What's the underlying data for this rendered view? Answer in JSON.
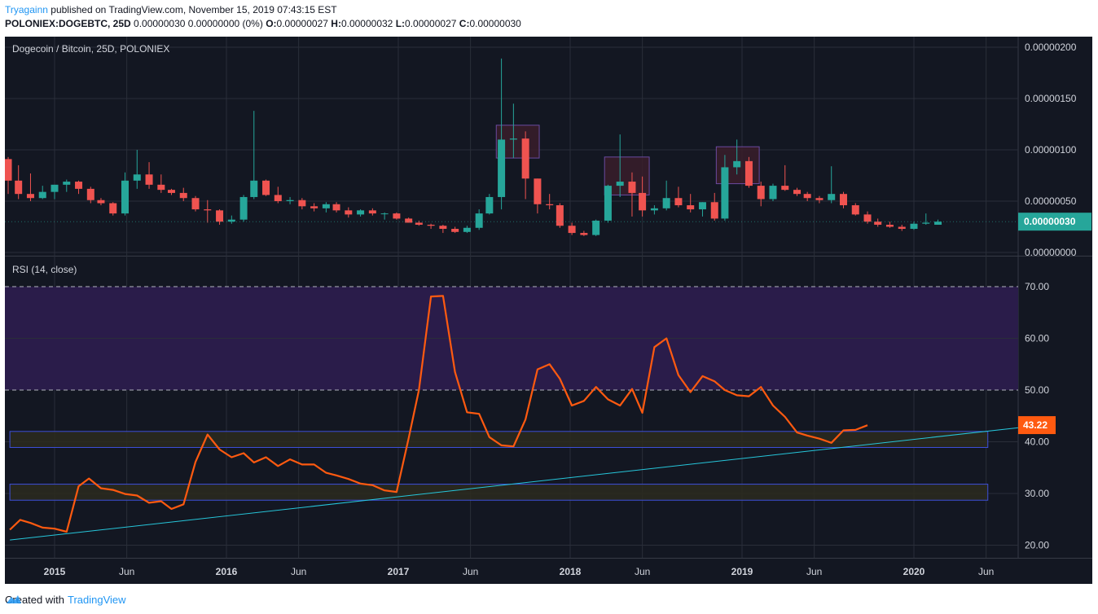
{
  "header": {
    "author": "Tryagainn",
    "published": "published on TradingView.com, November 15, 2019 07:43:15 EST",
    "symbol": "POLONIEX:DOGEBTC, 25D",
    "values_prefix": "0.00000030 0.00000000 (0%)",
    "o_label": "O:",
    "o_val": "0.00000027",
    "h_label": "H:",
    "h_val": "0.00000032",
    "l_label": "L:",
    "l_val": "0.00000027",
    "c_label": "C:",
    "c_val": "0.00000030"
  },
  "footer": {
    "created_with": "Created with",
    "brand": "TradingView"
  },
  "colors": {
    "background": "#131722",
    "grid": "#2a2e39",
    "up": "#26a69a",
    "down": "#ef5350",
    "rsi_line": "#ff5a10",
    "trend_line": "#26c6da",
    "overbought_zone": "#2a1c4a",
    "highlight_box": "#3a1d2a",
    "highlight_border": "#6a4aa0",
    "support_border": "#3d4fd8"
  },
  "chart_data": [
    {
      "type": "candlestick",
      "title": "Dogecoin / Bitcoin, 25D, POLONIEX",
      "unit_note": "price in BTC",
      "ylim": [
        0,
        2e-06
      ],
      "y_ticks": [
        "0.00000200",
        "0.00000150",
        "0.00000100",
        "0.00000050",
        "0.00000000"
      ],
      "last_price_label": "0.00000030",
      "x_ticks": [
        "2015",
        "Jun",
        "2016",
        "Jun",
        "2017",
        "Jun",
        "2018",
        "Jun",
        "2019",
        "Jun",
        "2020",
        "Jun"
      ],
      "x_tick_times": [
        2015.0,
        2015.42,
        2016.0,
        2016.42,
        2017.0,
        2017.42,
        2018.0,
        2018.42,
        2019.0,
        2019.42,
        2020.0,
        2020.42
      ],
      "candles": [
        {
          "t": 2014.73,
          "o": 0.91,
          "h": 0.93,
          "l": 0.57,
          "c": 0.7
        },
        {
          "t": 2014.79,
          "o": 0.7,
          "h": 0.85,
          "l": 0.52,
          "c": 0.57
        },
        {
          "t": 2014.86,
          "o": 0.57,
          "h": 0.77,
          "l": 0.5,
          "c": 0.53
        },
        {
          "t": 2014.93,
          "o": 0.53,
          "h": 0.65,
          "l": 0.52,
          "c": 0.59
        },
        {
          "t": 2015.0,
          "o": 0.59,
          "h": 0.66,
          "l": 0.52,
          "c": 0.66
        },
        {
          "t": 2015.07,
          "o": 0.66,
          "h": 0.71,
          "l": 0.59,
          "c": 0.69
        },
        {
          "t": 2015.14,
          "o": 0.69,
          "h": 0.7,
          "l": 0.57,
          "c": 0.62
        },
        {
          "t": 2015.21,
          "o": 0.62,
          "h": 0.64,
          "l": 0.48,
          "c": 0.51
        },
        {
          "t": 2015.27,
          "o": 0.51,
          "h": 0.53,
          "l": 0.46,
          "c": 0.48
        },
        {
          "t": 2015.34,
          "o": 0.48,
          "h": 0.49,
          "l": 0.36,
          "c": 0.38
        },
        {
          "t": 2015.41,
          "o": 0.38,
          "h": 0.78,
          "l": 0.36,
          "c": 0.7
        },
        {
          "t": 2015.48,
          "o": 0.7,
          "h": 1.0,
          "l": 0.62,
          "c": 0.76
        },
        {
          "t": 2015.55,
          "o": 0.76,
          "h": 0.88,
          "l": 0.62,
          "c": 0.66
        },
        {
          "t": 2015.62,
          "o": 0.66,
          "h": 0.76,
          "l": 0.58,
          "c": 0.61
        },
        {
          "t": 2015.68,
          "o": 0.61,
          "h": 0.62,
          "l": 0.56,
          "c": 0.58
        },
        {
          "t": 2015.75,
          "o": 0.58,
          "h": 0.63,
          "l": 0.5,
          "c": 0.53
        },
        {
          "t": 2015.82,
          "o": 0.53,
          "h": 0.55,
          "l": 0.4,
          "c": 0.42
        },
        {
          "t": 2015.89,
          "o": 0.42,
          "h": 0.51,
          "l": 0.29,
          "c": 0.41
        },
        {
          "t": 2015.96,
          "o": 0.41,
          "h": 0.42,
          "l": 0.27,
          "c": 0.3
        },
        {
          "t": 2016.03,
          "o": 0.3,
          "h": 0.36,
          "l": 0.28,
          "c": 0.32
        },
        {
          "t": 2016.1,
          "o": 0.32,
          "h": 0.56,
          "l": 0.3,
          "c": 0.54
        },
        {
          "t": 2016.16,
          "o": 0.54,
          "h": 1.38,
          "l": 0.52,
          "c": 0.7
        },
        {
          "t": 2016.23,
          "o": 0.7,
          "h": 0.71,
          "l": 0.55,
          "c": 0.56
        },
        {
          "t": 2016.3,
          "o": 0.56,
          "h": 0.64,
          "l": 0.48,
          "c": 0.5
        },
        {
          "t": 2016.37,
          "o": 0.5,
          "h": 0.54,
          "l": 0.47,
          "c": 0.51
        },
        {
          "t": 2016.44,
          "o": 0.51,
          "h": 0.53,
          "l": 0.42,
          "c": 0.45
        },
        {
          "t": 2016.51,
          "o": 0.45,
          "h": 0.48,
          "l": 0.4,
          "c": 0.43
        },
        {
          "t": 2016.58,
          "o": 0.43,
          "h": 0.49,
          "l": 0.39,
          "c": 0.47
        },
        {
          "t": 2016.64,
          "o": 0.47,
          "h": 0.49,
          "l": 0.39,
          "c": 0.41
        },
        {
          "t": 2016.71,
          "o": 0.41,
          "h": 0.44,
          "l": 0.34,
          "c": 0.37
        },
        {
          "t": 2016.78,
          "o": 0.37,
          "h": 0.42,
          "l": 0.35,
          "c": 0.41
        },
        {
          "t": 2016.85,
          "o": 0.41,
          "h": 0.43,
          "l": 0.36,
          "c": 0.38
        },
        {
          "t": 2016.92,
          "o": 0.38,
          "h": 0.39,
          "l": 0.32,
          "c": 0.38
        },
        {
          "t": 2016.99,
          "o": 0.38,
          "h": 0.39,
          "l": 0.32,
          "c": 0.33
        },
        {
          "t": 2017.06,
          "o": 0.33,
          "h": 0.34,
          "l": 0.29,
          "c": 0.29
        },
        {
          "t": 2017.12,
          "o": 0.29,
          "h": 0.31,
          "l": 0.26,
          "c": 0.27
        },
        {
          "t": 2017.19,
          "o": 0.27,
          "h": 0.28,
          "l": 0.23,
          "c": 0.26
        },
        {
          "t": 2017.26,
          "o": 0.26,
          "h": 0.27,
          "l": 0.19,
          "c": 0.23
        },
        {
          "t": 2017.33,
          "o": 0.23,
          "h": 0.25,
          "l": 0.19,
          "c": 0.2
        },
        {
          "t": 2017.4,
          "o": 0.2,
          "h": 0.26,
          "l": 0.19,
          "c": 0.24
        },
        {
          "t": 2017.47,
          "o": 0.24,
          "h": 0.42,
          "l": 0.22,
          "c": 0.38
        },
        {
          "t": 2017.53,
          "o": 0.38,
          "h": 0.57,
          "l": 0.37,
          "c": 0.54
        },
        {
          "t": 2017.6,
          "o": 0.54,
          "h": 1.89,
          "l": 0.42,
          "c": 1.1
        },
        {
          "t": 2017.67,
          "o": 1.1,
          "h": 1.45,
          "l": 0.92,
          "c": 1.11
        },
        {
          "t": 2017.74,
          "o": 1.11,
          "h": 1.18,
          "l": 0.52,
          "c": 0.72
        },
        {
          "t": 2017.81,
          "o": 0.72,
          "h": 0.72,
          "l": 0.38,
          "c": 0.47
        },
        {
          "t": 2017.88,
          "o": 0.47,
          "h": 0.57,
          "l": 0.42,
          "c": 0.46
        },
        {
          "t": 2017.94,
          "o": 0.46,
          "h": 0.48,
          "l": 0.24,
          "c": 0.26
        },
        {
          "t": 2018.01,
          "o": 0.26,
          "h": 0.29,
          "l": 0.17,
          "c": 0.19
        },
        {
          "t": 2018.08,
          "o": 0.19,
          "h": 0.21,
          "l": 0.16,
          "c": 0.17
        },
        {
          "t": 2018.15,
          "o": 0.17,
          "h": 0.32,
          "l": 0.16,
          "c": 0.31
        },
        {
          "t": 2018.22,
          "o": 0.31,
          "h": 0.66,
          "l": 0.29,
          "c": 0.65
        },
        {
          "t": 2018.29,
          "o": 0.65,
          "h": 1.15,
          "l": 0.54,
          "c": 0.69
        },
        {
          "t": 2018.36,
          "o": 0.69,
          "h": 0.78,
          "l": 0.35,
          "c": 0.58
        },
        {
          "t": 2018.42,
          "o": 0.58,
          "h": 0.74,
          "l": 0.35,
          "c": 0.41
        },
        {
          "t": 2018.49,
          "o": 0.41,
          "h": 0.46,
          "l": 0.37,
          "c": 0.43
        },
        {
          "t": 2018.56,
          "o": 0.43,
          "h": 0.7,
          "l": 0.41,
          "c": 0.53
        },
        {
          "t": 2018.63,
          "o": 0.53,
          "h": 0.64,
          "l": 0.44,
          "c": 0.46
        },
        {
          "t": 2018.7,
          "o": 0.46,
          "h": 0.57,
          "l": 0.39,
          "c": 0.42
        },
        {
          "t": 2018.77,
          "o": 0.42,
          "h": 0.49,
          "l": 0.35,
          "c": 0.49
        },
        {
          "t": 2018.84,
          "o": 0.49,
          "h": 0.58,
          "l": 0.31,
          "c": 0.33
        },
        {
          "t": 2018.9,
          "o": 0.33,
          "h": 0.95,
          "l": 0.31,
          "c": 0.83
        },
        {
          "t": 2018.97,
          "o": 0.83,
          "h": 1.1,
          "l": 0.76,
          "c": 0.89
        },
        {
          "t": 2019.04,
          "o": 0.89,
          "h": 0.93,
          "l": 0.63,
          "c": 0.65
        },
        {
          "t": 2019.11,
          "o": 0.65,
          "h": 0.69,
          "l": 0.45,
          "c": 0.52
        },
        {
          "t": 2019.18,
          "o": 0.52,
          "h": 0.67,
          "l": 0.5,
          "c": 0.65
        },
        {
          "t": 2019.25,
          "o": 0.65,
          "h": 0.85,
          "l": 0.6,
          "c": 0.61
        },
        {
          "t": 2019.32,
          "o": 0.61,
          "h": 0.63,
          "l": 0.55,
          "c": 0.57
        },
        {
          "t": 2019.38,
          "o": 0.57,
          "h": 0.59,
          "l": 0.5,
          "c": 0.53
        },
        {
          "t": 2019.45,
          "o": 0.53,
          "h": 0.55,
          "l": 0.48,
          "c": 0.51
        },
        {
          "t": 2019.52,
          "o": 0.51,
          "h": 0.84,
          "l": 0.48,
          "c": 0.57
        },
        {
          "t": 2019.59,
          "o": 0.57,
          "h": 0.59,
          "l": 0.43,
          "c": 0.46
        },
        {
          "t": 2019.66,
          "o": 0.46,
          "h": 0.48,
          "l": 0.36,
          "c": 0.37
        },
        {
          "t": 2019.73,
          "o": 0.37,
          "h": 0.4,
          "l": 0.28,
          "c": 0.3
        },
        {
          "t": 2019.79,
          "o": 0.3,
          "h": 0.33,
          "l": 0.25,
          "c": 0.27
        },
        {
          "t": 2019.86,
          "o": 0.27,
          "h": 0.3,
          "l": 0.24,
          "c": 0.25
        },
        {
          "t": 2019.93,
          "o": 0.25,
          "h": 0.27,
          "l": 0.21,
          "c": 0.23
        },
        {
          "t": 2020.0,
          "o": 0.23,
          "h": 0.3,
          "l": 0.22,
          "c": 0.28
        },
        {
          "t": 2020.07,
          "o": 0.28,
          "h": 0.38,
          "l": 0.27,
          "c": 0.29
        },
        {
          "t": 2020.14,
          "o": 0.27,
          "h": 0.32,
          "l": 0.27,
          "c": 0.3
        }
      ],
      "price_scale_note": "candle values in units of 0.000001 BTC",
      "highlight_boxes": [
        {
          "t0": 2017.57,
          "t1": 2017.82,
          "p_low": 0.92,
          "p_high": 1.24
        },
        {
          "t0": 2018.2,
          "t1": 2018.46,
          "p_low": 0.56,
          "p_high": 0.93
        },
        {
          "t0": 2018.85,
          "t1": 2019.1,
          "p_low": 0.67,
          "p_high": 1.03
        }
      ]
    },
    {
      "type": "line",
      "title": "RSI (14, close)",
      "ylim": [
        17,
        78
      ],
      "y_ticks": [
        "70.00",
        "60.00",
        "50.00",
        "40.00",
        "30.00",
        "20.00"
      ],
      "levels": [
        70,
        50
      ],
      "last_value_label": "43.22",
      "x": [
        2014.74,
        2014.8,
        2014.86,
        2014.93,
        2015.0,
        2015.07,
        2015.14,
        2015.2,
        2015.27,
        2015.34,
        2015.41,
        2015.48,
        2015.55,
        2015.62,
        2015.68,
        2015.75,
        2015.82,
        2015.89,
        2015.96,
        2016.03,
        2016.1,
        2016.16,
        2016.23,
        2016.3,
        2016.37,
        2016.44,
        2016.51,
        2016.58,
        2016.64,
        2016.71,
        2016.78,
        2016.85,
        2016.92,
        2016.99,
        2017.06,
        2017.12,
        2017.19,
        2017.26,
        2017.33,
        2017.4,
        2017.47,
        2017.53,
        2017.6,
        2017.67,
        2017.74,
        2017.81,
        2017.88,
        2017.94,
        2018.01,
        2018.08,
        2018.15,
        2018.22,
        2018.29,
        2018.36,
        2018.42,
        2018.49,
        2018.56,
        2018.63,
        2018.7,
        2018.77,
        2018.84,
        2018.9,
        2018.97,
        2019.04,
        2019.11,
        2019.18,
        2019.25,
        2019.32,
        2019.38,
        2019.45,
        2019.52,
        2019.59,
        2019.66,
        2019.73,
        2019.79,
        2019.86,
        2019.93,
        2020.0,
        2020.07,
        2020.14
      ],
      "values": [
        23.0,
        24.9,
        24.3,
        23.4,
        23.2,
        22.6,
        31.4,
        32.9,
        31.0,
        30.7,
        29.9,
        29.6,
        28.2,
        28.5,
        27.0,
        27.9,
        36.1,
        41.4,
        38.5,
        37.0,
        37.8,
        36.0,
        37.0,
        35.3,
        36.6,
        35.6,
        35.6,
        34.0,
        33.5,
        32.8,
        31.9,
        31.6,
        30.6,
        30.3,
        40.7,
        50.0,
        68.1,
        68.2,
        53.5,
        45.7,
        45.4,
        40.9,
        39.3,
        39.1,
        44.3,
        54.0,
        55.0,
        52.2,
        47.0,
        47.9,
        50.6,
        48.2,
        47.0,
        50.2,
        45.6,
        58.3,
        60.0,
        52.9,
        49.6,
        52.7,
        51.7,
        50.0,
        49.0,
        48.8,
        50.6,
        47.0,
        44.8,
        41.8,
        41.2,
        40.6,
        39.8,
        42.2,
        42.3,
        43.2
      ],
      "support_zones": [
        {
          "t0": 2014.74,
          "t1": 2020.43,
          "low": 38.9,
          "high": 42.0
        },
        {
          "t0": 2014.74,
          "t1": 2020.43,
          "low": 28.7,
          "high": 31.8
        }
      ],
      "trend_line": {
        "t0": 2014.74,
        "v0": 21.0,
        "t1": 2020.63,
        "v1": 42.8
      }
    }
  ]
}
